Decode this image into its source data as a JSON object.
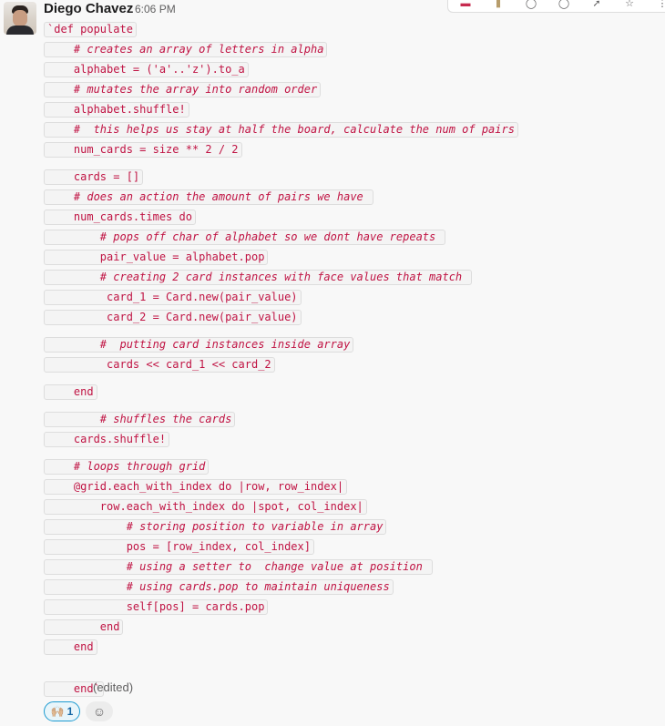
{
  "message": {
    "author": "Diego Chavez",
    "time": "6:06 PM",
    "edited_label": "(edited)"
  },
  "toolbar_icons": [
    "emoji-icon",
    "hands-icon",
    "check-icon",
    "reply-icon",
    "forward-icon",
    "star-icon",
    "more-icon"
  ],
  "code_lines": [
    {
      "text": "`def populate",
      "comment": false
    },
    {
      "text": "    # creates an array of letters in alpha",
      "comment": true
    },
    {
      "text": "    alphabet = ('a'..'z').to_a",
      "comment": false
    },
    {
      "text": "    # mutates the array into random order",
      "comment": true
    },
    {
      "text": "    alphabet.shuffle!",
      "comment": false
    },
    {
      "text": "    #  this helps us stay at half the board, calculate the num of pairs",
      "comment": true
    },
    {
      "text": "    num_cards = size ** 2 / 2",
      "comment": false
    },
    {
      "text": "    cards = []",
      "comment": false
    },
    {
      "text": "    # does an action the amount of pairs we have ",
      "comment": true
    },
    {
      "text": "    num_cards.times do",
      "comment": false
    },
    {
      "text": "        # pops off char of alphabet so we dont have repeats ",
      "comment": true
    },
    {
      "text": "        pair_value = alphabet.pop",
      "comment": false
    },
    {
      "text": "        # creating 2 card instances with face values that match ",
      "comment": true
    },
    {
      "text": "         card_1 = Card.new(pair_value)",
      "comment": false
    },
    {
      "text": "         card_2 = Card.new(pair_value)",
      "comment": false
    },
    {
      "text": "        #  putting card instances inside array",
      "comment": true
    },
    {
      "text": "         cards << card_1 << card_2",
      "comment": false
    },
    {
      "text": "    end",
      "comment": false
    },
    {
      "text": "        # shuffles the cards",
      "comment": true
    },
    {
      "text": "    cards.shuffle!",
      "comment": false
    },
    {
      "text": "    # loops through grid",
      "comment": true
    },
    {
      "text": "    @grid.each_with_index do |row, row_index|",
      "comment": false
    },
    {
      "text": "        row.each_with_index do |spot, col_index|",
      "comment": false
    },
    {
      "text": "            # storing position to variable in array",
      "comment": true
    },
    {
      "text": "            pos = [row_index, col_index]",
      "comment": false
    },
    {
      "text": "            # using a setter to  change value at position ",
      "comment": true
    },
    {
      "text": "            # using cards.pop to maintain uniqueness",
      "comment": true
    },
    {
      "text": "            self[pos] = cards.pop",
      "comment": false
    },
    {
      "text": "        end",
      "comment": false
    },
    {
      "text": "    end",
      "comment": false
    },
    {
      "text": "    end`",
      "comment": false
    }
  ],
  "reactions": [
    {
      "emoji": "🙌🏼",
      "count": "1"
    }
  ],
  "add_reaction_icon": "add-reaction-icon"
}
